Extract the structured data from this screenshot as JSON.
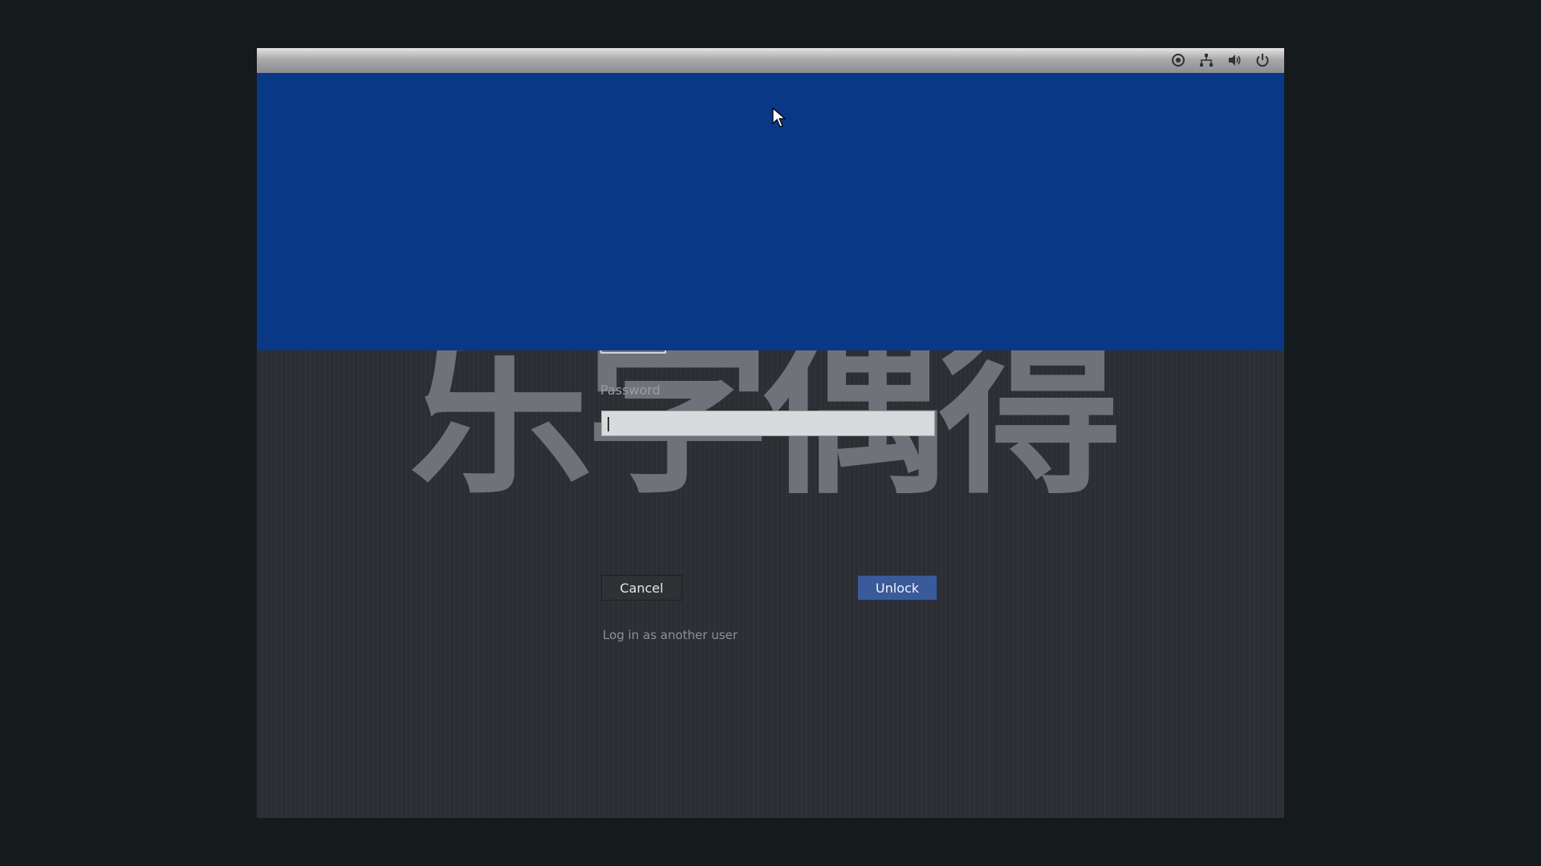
{
  "panel": {
    "status_icons": [
      "accessibility-icon",
      "network-icon",
      "volume-icon",
      "power-icon"
    ]
  },
  "watermark": {
    "text": "乐学偶得"
  },
  "login": {
    "password_label": "Password",
    "password_value": "",
    "cancel_label": "Cancel",
    "unlock_label": "Unlock",
    "another_user_label": "Log in as another user"
  },
  "colors": {
    "accent_blue": "#083886",
    "unlock_button": "#3a5a9a",
    "background": "#2c2e33"
  }
}
